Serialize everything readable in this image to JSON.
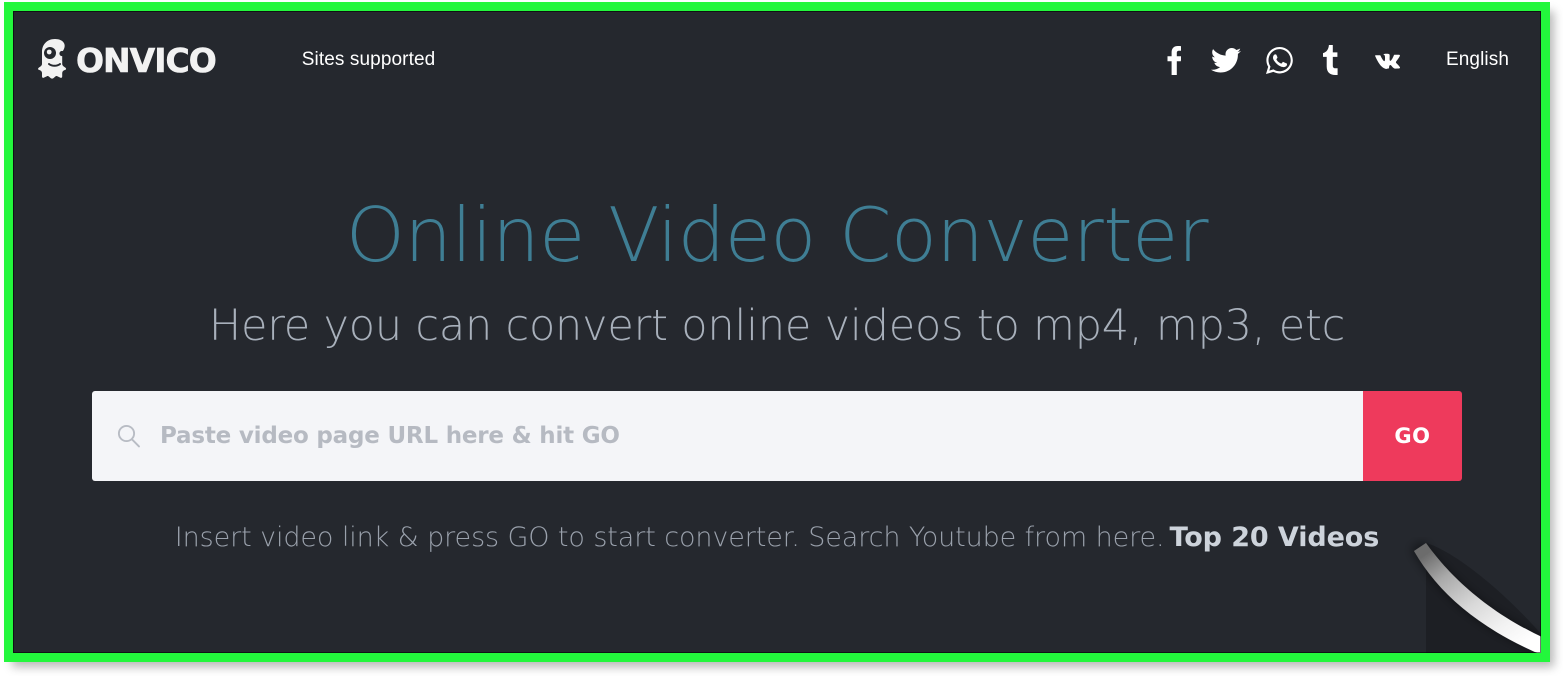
{
  "theme": {
    "frame_border_color": "#23f73c",
    "page_background": "#25282e",
    "heading_color": "#3f7e94",
    "subheading_color": "#a8b0bb",
    "accent_button_color": "#ee3a5c",
    "input_background": "#f4f5f8"
  },
  "header": {
    "brand_name": "ONVICO",
    "brand_icon": "monster-mascot-icon",
    "nav": [
      {
        "label": "Sites supported",
        "name": "nav-sites-supported"
      }
    ],
    "social": [
      {
        "name": "facebook-icon",
        "label": "Facebook"
      },
      {
        "name": "twitter-icon",
        "label": "Twitter"
      },
      {
        "name": "whatsapp-icon",
        "label": "WhatsApp"
      },
      {
        "name": "tumblr-icon",
        "label": "Tumblr"
      },
      {
        "name": "vk-icon",
        "label": "VK"
      }
    ],
    "language": "English"
  },
  "hero": {
    "title": "Online Video Converter",
    "subtitle": "Here you can convert online videos to mp4, mp3, etc",
    "hint_text": "Insert video link & press GO to start converter. Search Youtube from here.",
    "hint_link": "Top 20 Videos"
  },
  "search": {
    "placeholder": "Paste video page URL here & hit GO",
    "value": "",
    "icon": "search-icon",
    "submit_label": "GO"
  }
}
